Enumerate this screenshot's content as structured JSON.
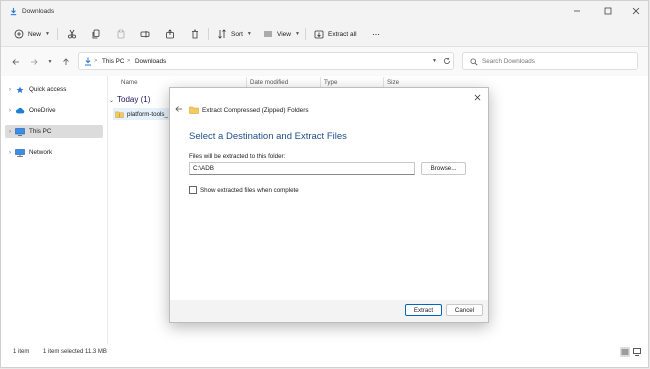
{
  "window": {
    "title": "Downloads"
  },
  "commandbar": {
    "new_label": "New",
    "sort_label": "Sort",
    "view_label": "View",
    "extract_all_label": "Extract all",
    "more_label": "···"
  },
  "address": {
    "crumbs": [
      "This PC",
      "Downloads"
    ],
    "separator": ">"
  },
  "search": {
    "placeholder": "Search Downloads"
  },
  "sidebar": {
    "items": [
      {
        "label": "Quick access",
        "icon": "star-icon"
      },
      {
        "label": "OneDrive",
        "icon": "cloud-icon"
      },
      {
        "label": "This PC",
        "icon": "computer-icon",
        "selected": true
      },
      {
        "label": "Network",
        "icon": "network-icon"
      }
    ]
  },
  "filelist": {
    "columns": [
      "Name",
      "Date modified",
      "Type",
      "Size"
    ],
    "group_label": "Today (1)",
    "rows": [
      {
        "name": "platform-tools_"
      }
    ]
  },
  "statusbar": {
    "item_count": "1 item",
    "selection": "1 item selected  11.3 MB"
  },
  "dialog": {
    "title": "Extract Compressed (Zipped) Folders",
    "heading": "Select a Destination and Extract Files",
    "path_label": "Files will be extracted to this folder:",
    "path_value": "C:\\ADB",
    "browse_label": "Browse...",
    "checkbox_label": "Show extracted files when complete",
    "checkbox_checked": false,
    "extract_label": "Extract",
    "cancel_label": "Cancel"
  },
  "colors": {
    "accent": "#0067c0",
    "heading_blue": "#1f4e8c",
    "folder_yellow": "#f4c95d",
    "selection_bg": "#dcdcdc"
  }
}
